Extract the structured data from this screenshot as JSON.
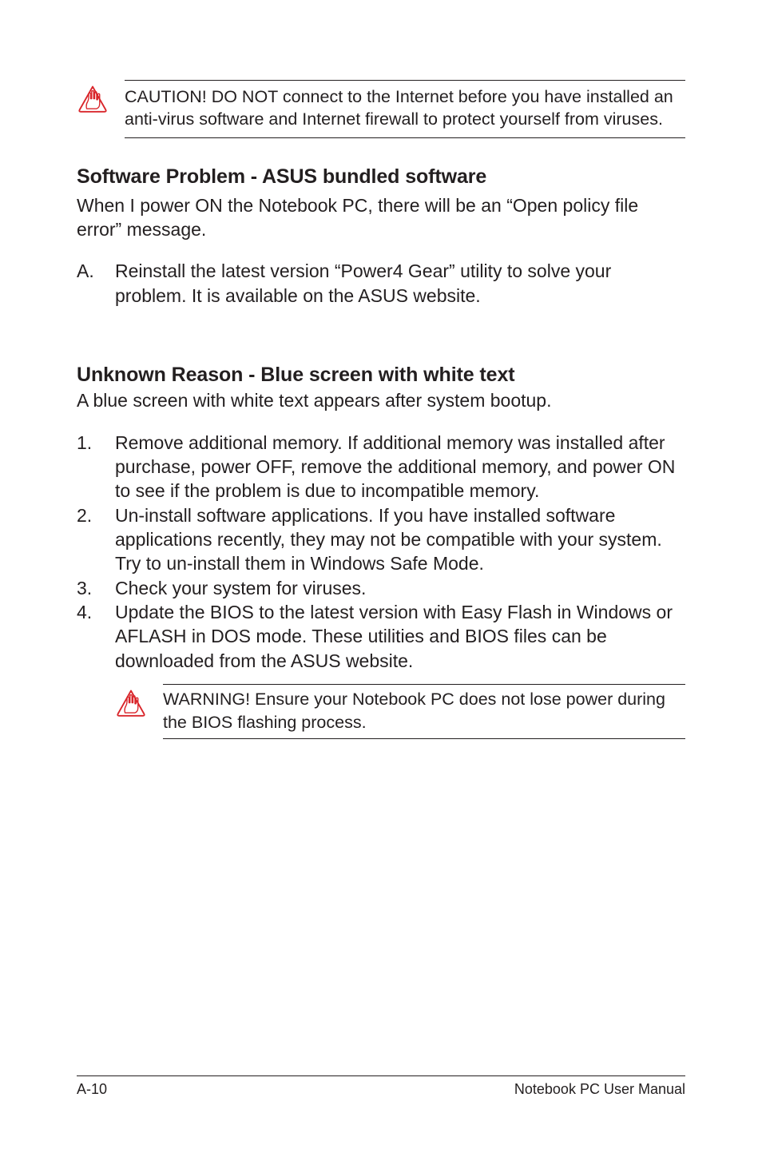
{
  "callout1": {
    "text": "CAUTION! DO NOT connect to the Internet before you have installed an anti-virus software and Internet firewall to protect yourself from viruses."
  },
  "section1": {
    "heading": "Software Problem - ASUS bundled software",
    "intro": "When I power ON the Notebook PC, there will be an “Open policy file error” message.",
    "items": [
      {
        "marker": "A.",
        "text": "Reinstall the latest version “Power4 Gear” utility to solve your problem. It is available on the ASUS website."
      }
    ]
  },
  "section2": {
    "heading": "Unknown Reason - Blue screen with white text",
    "intro": "A blue screen with white text appears after system bootup.",
    "items": [
      {
        "marker": "1.",
        "text": "Remove additional memory. If additional memory was installed after purchase, power OFF, remove the additional memory, and power ON to see if the problem is due to incompatible memory."
      },
      {
        "marker": "2.",
        "text": "Un-install software applications. If you have installed software applications recently, they may not be compatible with your system. Try to un-install them in Windows Safe Mode."
      },
      {
        "marker": "3.",
        "text": "Check your system for viruses."
      },
      {
        "marker": "4.",
        "text": "Update the BIOS to the latest version with Easy Flash in Windows or AFLASH in DOS mode. These utilities and BIOS files can be downloaded from the ASUS website."
      }
    ]
  },
  "callout2": {
    "text": "WARNING! Ensure your Notebook PC does not lose power during the BIOS flashing process."
  },
  "footer": {
    "left": "A-10",
    "right": "Notebook PC User Manual"
  }
}
